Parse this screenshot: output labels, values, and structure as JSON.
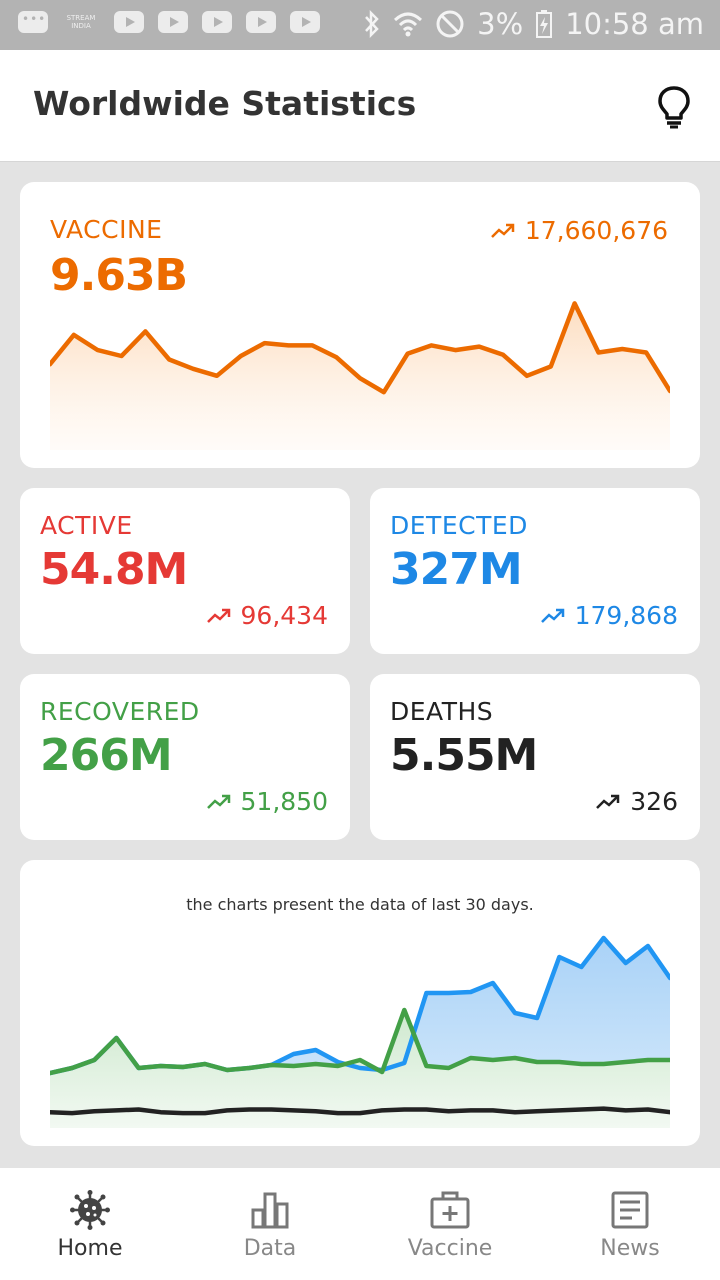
{
  "status_bar": {
    "stream_label": "STREAM INDIA",
    "battery": "3%",
    "time": "10:58 am"
  },
  "header": {
    "title": "Worldwide Statistics",
    "theme_icon": "lightbulb-icon"
  },
  "vaccine": {
    "label": "VACCINE",
    "total": "9.63B",
    "daily": "17,660,676",
    "color": "#ec6b00",
    "trend_values": [
      70,
      95,
      82,
      77,
      98,
      74,
      66,
      60,
      77,
      88,
      86,
      86,
      76,
      58,
      46,
      79,
      86,
      82,
      85,
      78,
      60,
      68,
      122,
      80,
      83,
      80,
      47
    ]
  },
  "stats": {
    "active": {
      "label": "ACTIVE",
      "total": "54.8M",
      "daily": "96,434",
      "color": "#e53935"
    },
    "detected": {
      "label": "DETECTED",
      "total": "327M",
      "daily": "179,868",
      "color": "#1e88e5"
    },
    "recovered": {
      "label": "RECOVERED",
      "total": "266M",
      "daily": "51,850",
      "color": "#43a047"
    },
    "deaths": {
      "label": "DEATHS",
      "total": "5.55M",
      "daily": "326",
      "color": "#222222"
    }
  },
  "comparison": {
    "caption": "the charts present the data of last 30 days.",
    "colors": {
      "detected": "#2196f3",
      "recovered": "#43a047",
      "deaths": "#222222"
    },
    "detected_values": [
      55,
      60,
      68,
      90,
      60,
      62,
      61,
      64,
      58,
      60,
      63,
      74,
      78,
      66,
      60,
      58,
      65,
      135,
      135,
      136,
      145,
      115,
      110,
      171,
      161,
      190,
      165,
      182,
      150
    ],
    "recovered_values": [
      55,
      60,
      68,
      90,
      60,
      62,
      61,
      64,
      58,
      60,
      63,
      62,
      64,
      62,
      68,
      56,
      118,
      62,
      60,
      70,
      68,
      70,
      66,
      66,
      64,
      64,
      66,
      68,
      68
    ],
    "deaths_values": [
      2,
      1,
      3,
      4,
      5,
      2,
      1,
      1,
      4,
      5,
      5,
      4,
      3,
      1,
      1,
      4,
      5,
      5,
      3,
      4,
      4,
      2,
      3,
      4,
      5,
      6,
      4,
      5,
      2
    ]
  },
  "nav": {
    "items": [
      {
        "label": "Home",
        "icon": "virus-icon",
        "active": true
      },
      {
        "label": "Data",
        "icon": "bar-chart-icon",
        "active": false
      },
      {
        "label": "Vaccine",
        "icon": "medical-kit-icon",
        "active": false
      },
      {
        "label": "News",
        "icon": "news-icon",
        "active": false
      }
    ]
  }
}
